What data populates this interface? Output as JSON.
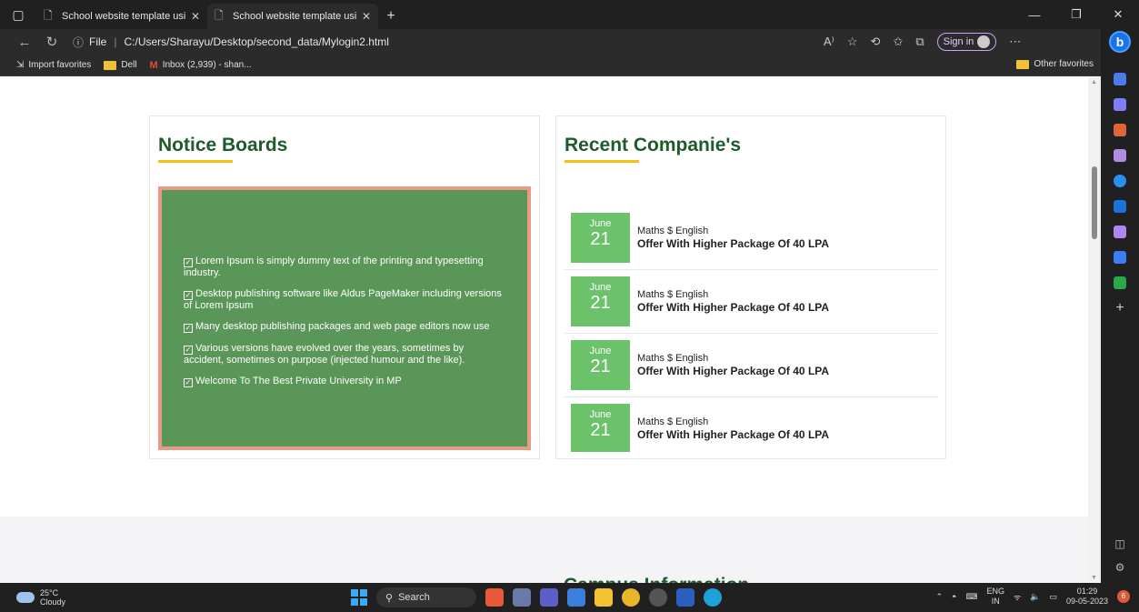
{
  "browser": {
    "tabs": [
      {
        "title": "School website template using p",
        "active": false
      },
      {
        "title": "School website template using p",
        "active": true
      }
    ],
    "url_scheme_label": "File",
    "url": "C:/Users/Sharayu/Desktop/second_data/Mylogin2.html",
    "sign_in_label": "Sign in",
    "favorites": [
      {
        "label": "Import favorites",
        "icon": "import-icon"
      },
      {
        "label": "Dell",
        "icon": "folder-icon"
      },
      {
        "label": "Inbox (2,939) - shan...",
        "icon": "gmail-icon"
      }
    ],
    "other_favorites": "Other favorites"
  },
  "page": {
    "notice": {
      "heading": "Notice Boards",
      "items": [
        "Lorem Ipsum is simply dummy text of the printing and typesetting industry.",
        "Desktop publishing software like Aldus PageMaker including versions of Lorem Ipsum",
        "Many desktop publishing packages and web page editors now use",
        "Various versions have evolved over the years, sometimes by accident, sometimes on purpose (injected humour and the like).",
        "Welcome To The Best Private University in MP"
      ]
    },
    "companies": {
      "heading": "Recent Companie's",
      "items": [
        {
          "month": "June",
          "day": "21",
          "subject": "Maths $ English",
          "title": "Offer With Higher Package Of 40 LPA"
        },
        {
          "month": "June",
          "day": "21",
          "subject": "Maths $ English",
          "title": "Offer With Higher Package Of 40 LPA"
        },
        {
          "month": "June",
          "day": "21",
          "subject": "Maths $ English",
          "title": "Offer With Higher Package Of 40 LPA"
        },
        {
          "month": "June",
          "day": "21",
          "subject": "Maths $ English",
          "title": "Offer With Higher Package Of 40 LPA"
        }
      ]
    },
    "campus_heading": "Campus Information",
    "colors": {
      "heading_green": "#1f5a2a",
      "accent_yellow": "#f4c20d",
      "notice_bg": "#5a9658",
      "notice_border": "#e89a86",
      "date_badge": "#6cc16b"
    }
  },
  "taskbar": {
    "weather_temp": "25°C",
    "weather_desc": "Cloudy",
    "search_label": "Search",
    "lang_top": "ENG",
    "lang_bottom": "IN",
    "time": "01:29",
    "date": "09-05-2023",
    "notification_count": "6"
  }
}
